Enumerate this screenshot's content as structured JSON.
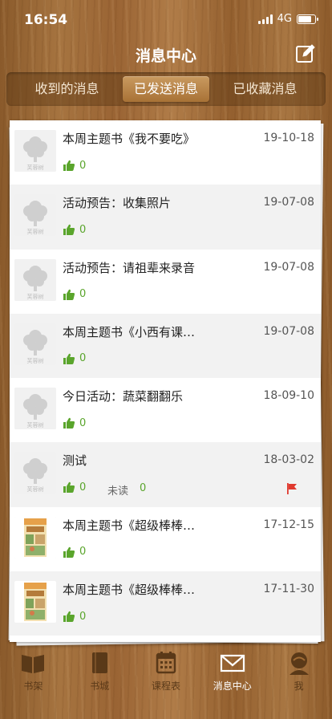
{
  "status_bar": {
    "time": "16:54",
    "network": "4G",
    "battery_level": 0.8
  },
  "header": {
    "title": "消息中心",
    "compose_icon": "compose-icon"
  },
  "segments": [
    {
      "label": "收到的消息",
      "active": false
    },
    {
      "label": "已发送消息",
      "active": true
    },
    {
      "label": "已收藏消息",
      "active": false
    }
  ],
  "messages": [
    {
      "title": "本周主题书《我不要吃》",
      "date": "19-10-18",
      "likes": "0",
      "thumb": "tree-logo"
    },
    {
      "title": "活动预告：收集照片",
      "date": "19-07-08",
      "likes": "0",
      "thumb": "tree-logo"
    },
    {
      "title": "活动预告：请祖辈来录音",
      "date": "19-07-08",
      "likes": "0",
      "thumb": "tree-logo"
    },
    {
      "title": "本周主题书《小西有课…",
      "date": "19-07-08",
      "likes": "0",
      "thumb": "tree-logo"
    },
    {
      "title": "今日活动：蔬菜翻翻乐",
      "date": "18-09-10",
      "likes": "0",
      "thumb": "tree-logo"
    },
    {
      "title": "测试",
      "date": "18-03-02",
      "likes": "0",
      "thumb": "tree-logo",
      "unread_label": "未读",
      "unread_count": "0",
      "flag": "red-flag-icon"
    },
    {
      "title": "本周主题书《超级棒棒…",
      "date": "17-12-15",
      "likes": "0",
      "thumb": "book-cover"
    },
    {
      "title": "本周主题书《超级棒棒…",
      "date": "17-11-30",
      "likes": "0",
      "thumb": "book-cover"
    }
  ],
  "thumb_logo_text": "芙蓉树",
  "tabs": [
    {
      "label": "书架",
      "icon": "bookshelf-icon",
      "active": false
    },
    {
      "label": "书城",
      "icon": "book-store-icon",
      "active": false
    },
    {
      "label": "课程表",
      "icon": "calendar-icon",
      "active": false
    },
    {
      "label": "消息中心",
      "icon": "envelope-icon",
      "active": true
    },
    {
      "label": "我",
      "icon": "person-icon",
      "active": false
    }
  ],
  "colors": {
    "like_green": "#5aa52c",
    "flag_red": "#e03a2f",
    "tab_inactive": "#5a3918",
    "tab_active": "#ffffff"
  }
}
